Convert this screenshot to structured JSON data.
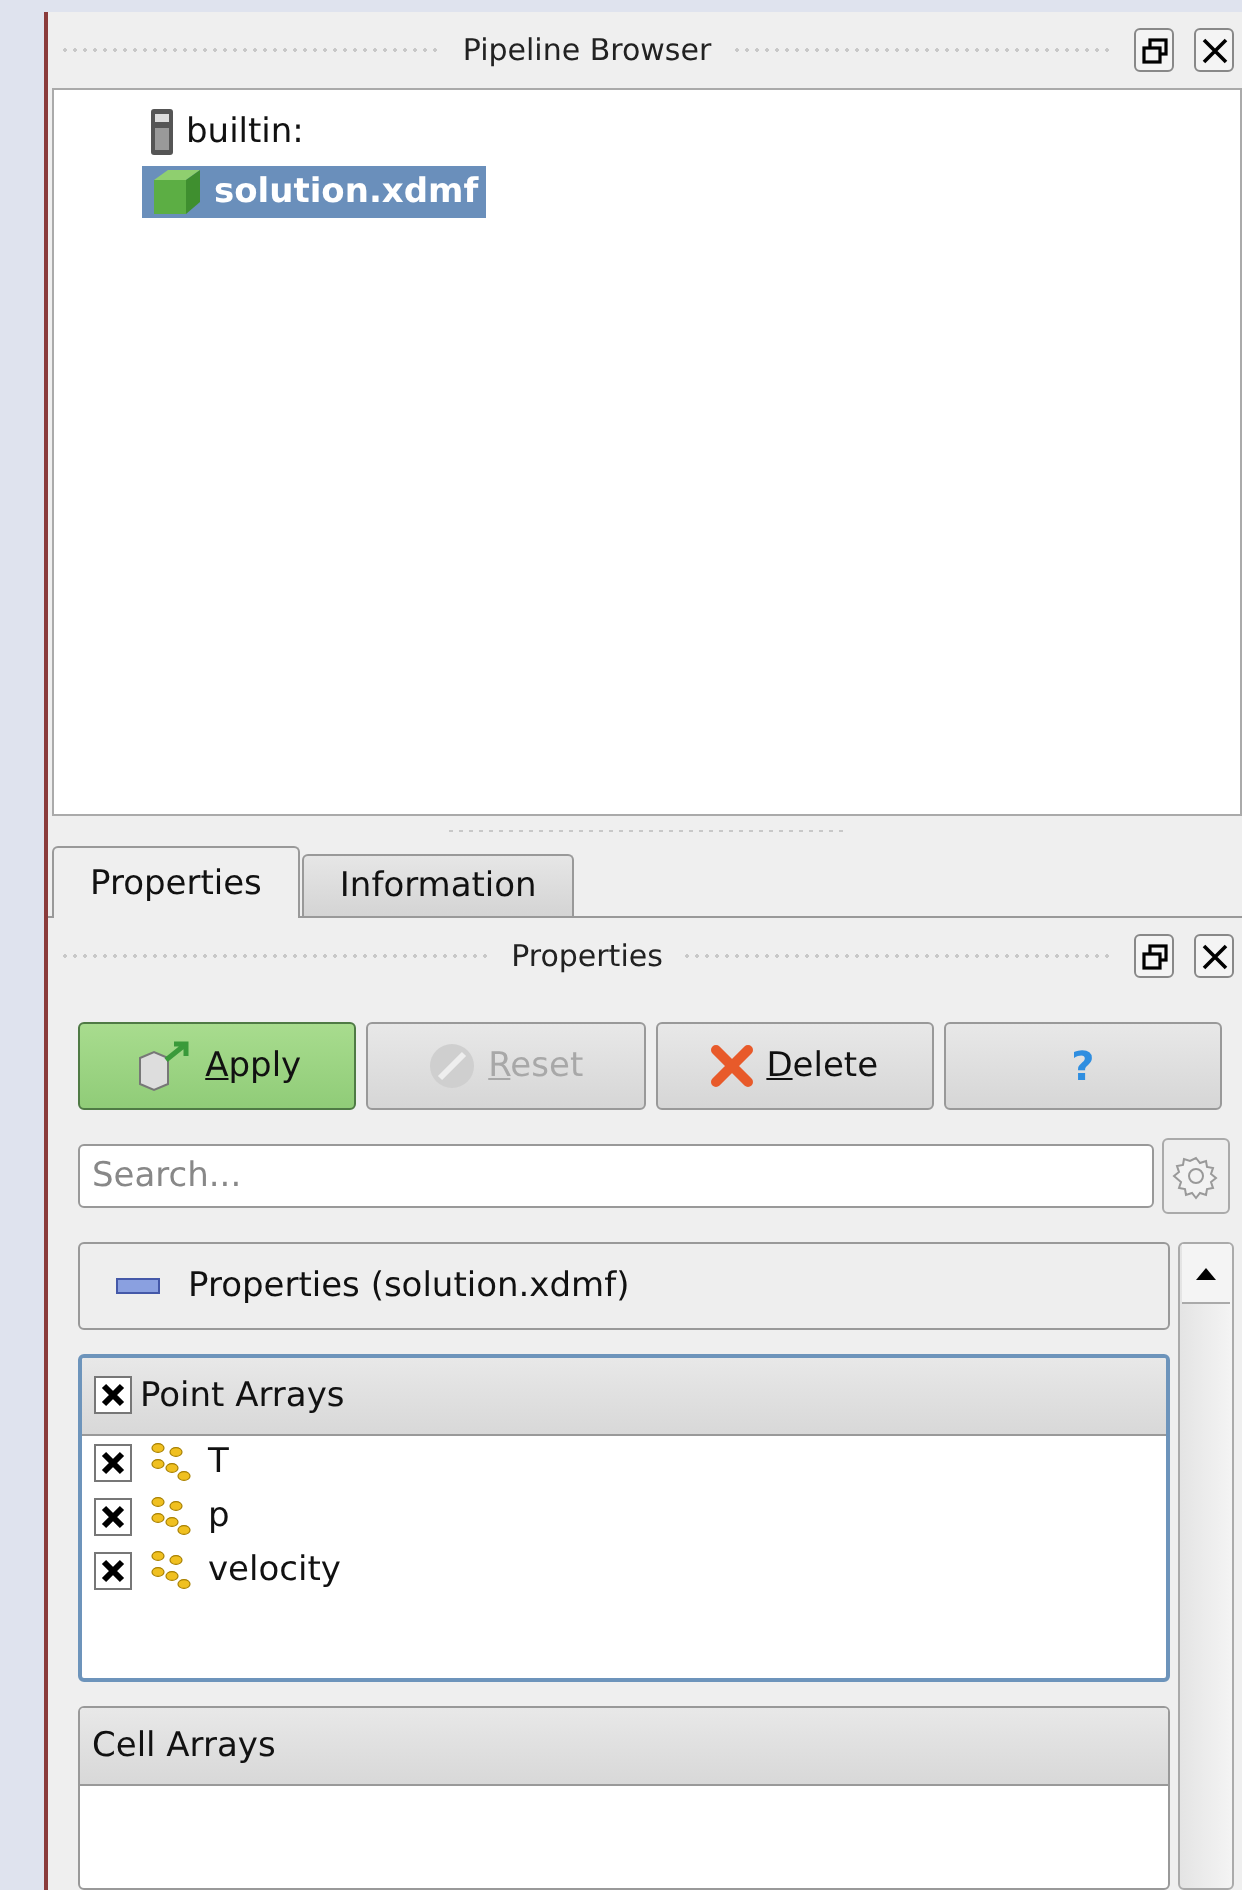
{
  "pipeline_browser": {
    "title": "Pipeline Browser",
    "tree": [
      {
        "label": "builtin:",
        "kind": "server",
        "selected": false,
        "children": [
          {
            "label": "solution.xdmf",
            "kind": "cube",
            "selected": true
          }
        ]
      }
    ]
  },
  "tabs": [
    {
      "label": "Properties",
      "selected": true
    },
    {
      "label": "Information",
      "selected": false
    }
  ],
  "properties_panel": {
    "title": "Properties",
    "buttons": [
      {
        "label": "Apply",
        "kind": "apply",
        "disabled": false
      },
      {
        "label": "Reset",
        "kind": "reset",
        "disabled": true
      },
      {
        "label": "Delete",
        "kind": "delete",
        "disabled": false
      },
      {
        "label": "?",
        "kind": "help",
        "disabled": false
      }
    ],
    "search": {
      "placeholder": "Search..."
    },
    "section": {
      "title": "Properties (solution.xdmf)",
      "expanded": true
    },
    "groups": [
      {
        "title": "Point Arrays",
        "checked": true,
        "focused": true,
        "items": [
          {
            "label": "T",
            "checked": true
          },
          {
            "label": "p",
            "checked": true
          },
          {
            "label": "velocity",
            "checked": true
          }
        ]
      },
      {
        "title": "Cell Arrays",
        "focused": false
      }
    ]
  }
}
